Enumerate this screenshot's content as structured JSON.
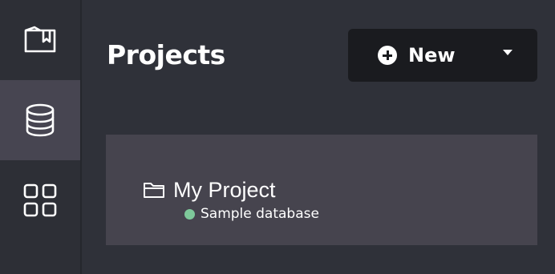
{
  "sidebar": {
    "items": [
      {
        "icon": "book-bookmark-icon",
        "active": false
      },
      {
        "icon": "database-icon",
        "active": true
      },
      {
        "icon": "grid-apps-icon",
        "active": false
      }
    ]
  },
  "header": {
    "title": "Projects",
    "new_button": {
      "label": "New",
      "icon": "plus-circle-icon",
      "dropdown_icon": "caret-down-icon"
    }
  },
  "projects": [
    {
      "name": "My Project",
      "icon": "folder-icon",
      "database": {
        "label": "Sample database",
        "status_color": "#7ec99a"
      }
    }
  ],
  "colors": {
    "background": "#2f3139",
    "sidebar_active": "#474551",
    "button_bg": "#1a1b1f",
    "card_bg": "#46444e",
    "text": "#ffffff"
  }
}
